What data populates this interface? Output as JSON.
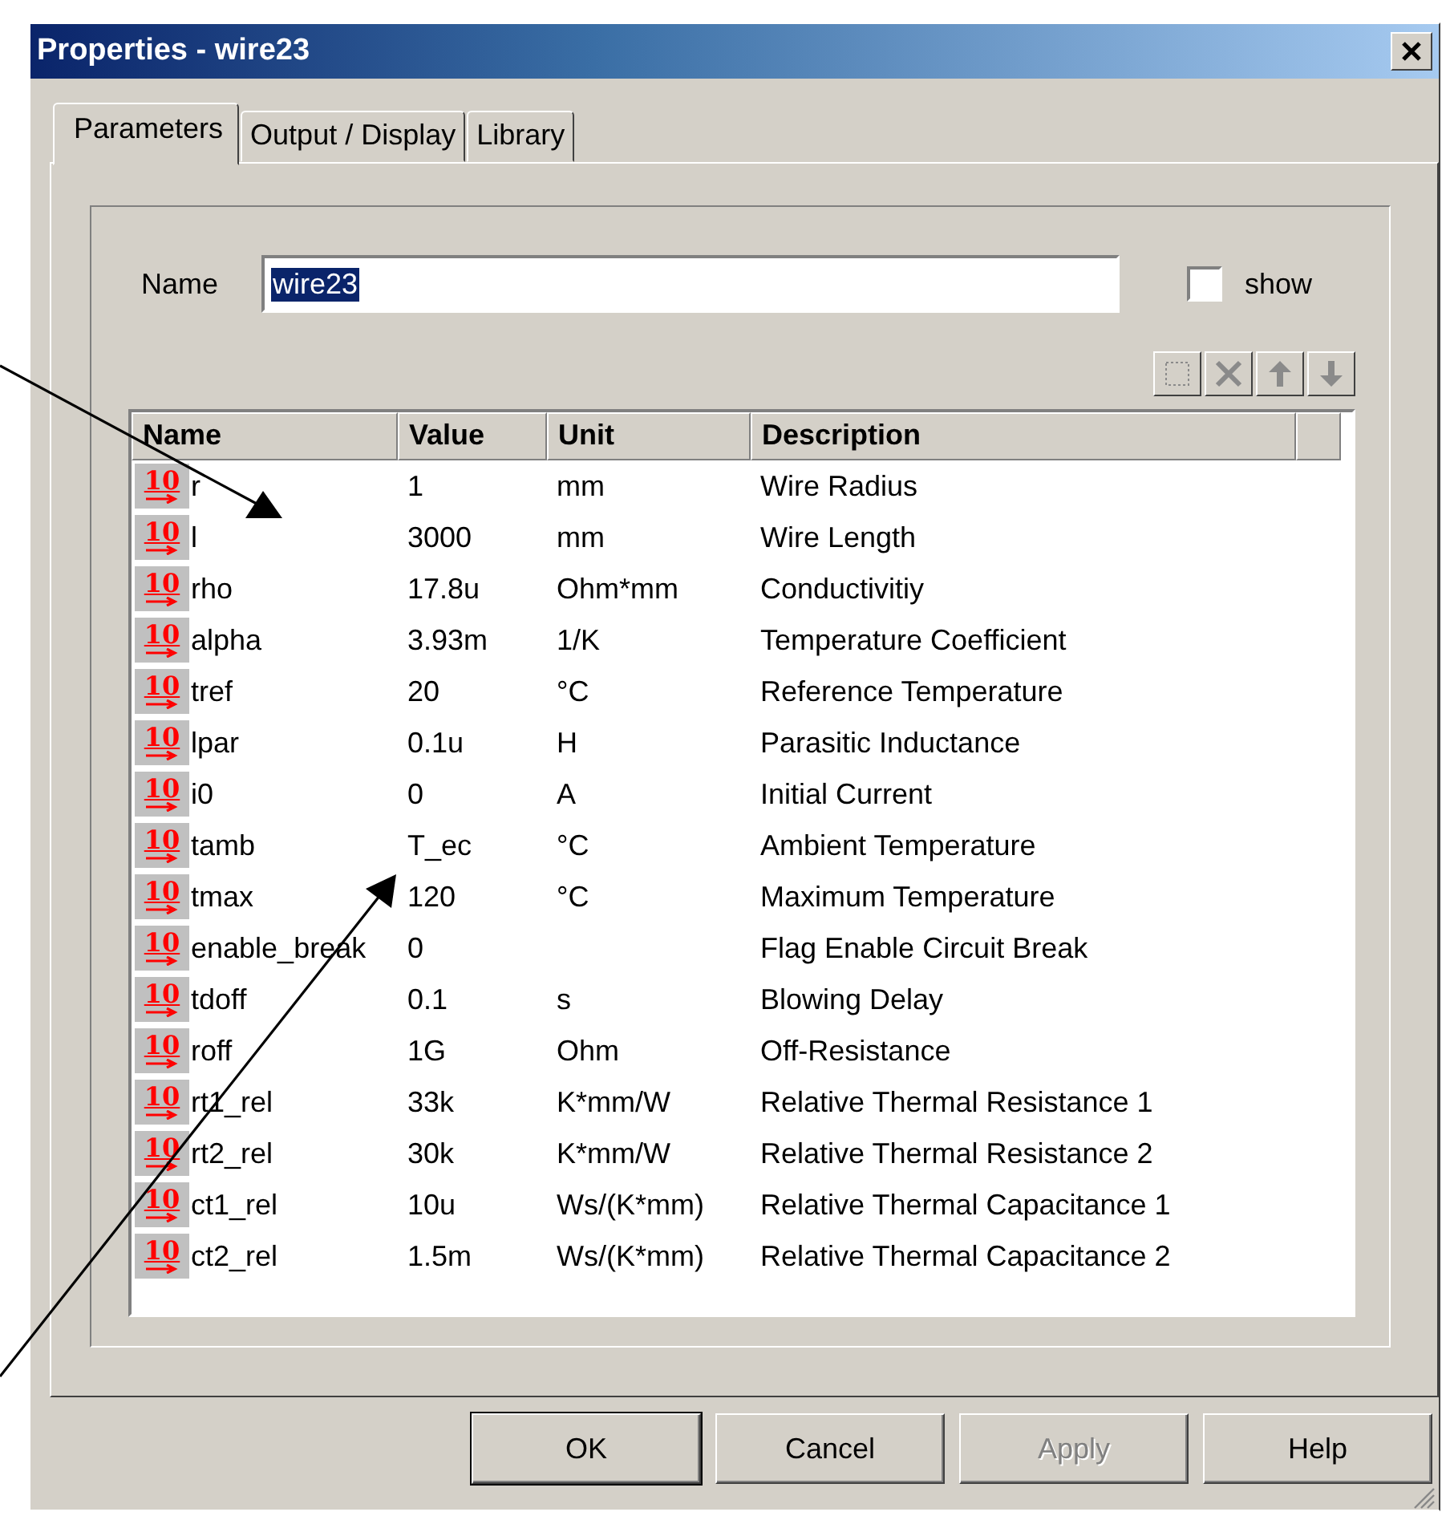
{
  "window": {
    "title": "Properties - wire23"
  },
  "tabs": [
    {
      "label": "Parameters",
      "selected": true
    },
    {
      "label": "Output / Display",
      "selected": false
    },
    {
      "label": "Library",
      "selected": false
    }
  ],
  "name_field": {
    "label": "Name",
    "value": "wire23",
    "selected": true
  },
  "show": {
    "label": "show",
    "checked": false
  },
  "toolbar": [
    {
      "kind": "new",
      "disabled": true
    },
    {
      "kind": "delete",
      "disabled": true
    },
    {
      "kind": "up",
      "disabled": true
    },
    {
      "kind": "down",
      "disabled": true
    }
  ],
  "table": {
    "columns": [
      "Name",
      "Value",
      "Unit",
      "Description"
    ],
    "rows": [
      {
        "icon": "10",
        "name": "r",
        "value": "1",
        "unit": "mm",
        "description": "Wire Radius"
      },
      {
        "icon": "10",
        "name": "l",
        "value": "3000",
        "unit": "mm",
        "description": "Wire Length"
      },
      {
        "icon": "10",
        "name": "rho",
        "value": "17.8u",
        "unit": "Ohm*mm",
        "description": "Conductivitiy"
      },
      {
        "icon": "10",
        "name": "alpha",
        "value": "3.93m",
        "unit": "1/K",
        "description": "Temperature Coefficient"
      },
      {
        "icon": "10",
        "name": "tref",
        "value": "20",
        "unit": "°C",
        "description": "Reference Temperature"
      },
      {
        "icon": "10",
        "name": "lpar",
        "value": "0.1u",
        "unit": "H",
        "description": "Parasitic Inductance"
      },
      {
        "icon": "10",
        "name": "i0",
        "value": "0",
        "unit": "A",
        "description": "Initial Current"
      },
      {
        "icon": "10",
        "name": "tamb",
        "value": "T_ec",
        "unit": "°C",
        "description": "Ambient Temperature"
      },
      {
        "icon": "10",
        "name": "tmax",
        "value": "120",
        "unit": "°C",
        "description": "Maximum Temperature"
      },
      {
        "icon": "10",
        "name": "enable_break",
        "value": "0",
        "description": "Flag Enable Circuit Break"
      },
      {
        "icon": "10",
        "name": "tdoff",
        "value": "0.1",
        "unit": "s",
        "description": "Blowing Delay"
      },
      {
        "icon": "10",
        "name": "roff",
        "value": "1G",
        "unit": "Ohm",
        "description": "Off-Resistance"
      },
      {
        "icon": "10",
        "name": "rt1_rel",
        "value": "33k",
        "unit": "K*mm/W",
        "description": "Relative Thermal Resistance 1"
      },
      {
        "icon": "10",
        "name": "rt2_rel",
        "value": "30k",
        "unit": "K*mm/W",
        "description": "Relative Thermal Resistance 2"
      },
      {
        "icon": "10",
        "name": "ct1_rel",
        "value": "10u",
        "unit": "Ws/(K*mm)",
        "description": "Relative Thermal Capacitance 1"
      },
      {
        "icon": "10",
        "name": "ct2_rel",
        "value": "1.5m",
        "unit": "Ws/(K*mm)",
        "description": "Relative Thermal Capacitance 2"
      }
    ]
  },
  "buttons": [
    {
      "label": "OK",
      "disabled": false
    },
    {
      "label": "Cancel",
      "disabled": false
    },
    {
      "label": "Apply",
      "disabled": true
    },
    {
      "label": "Help",
      "disabled": false
    }
  ]
}
